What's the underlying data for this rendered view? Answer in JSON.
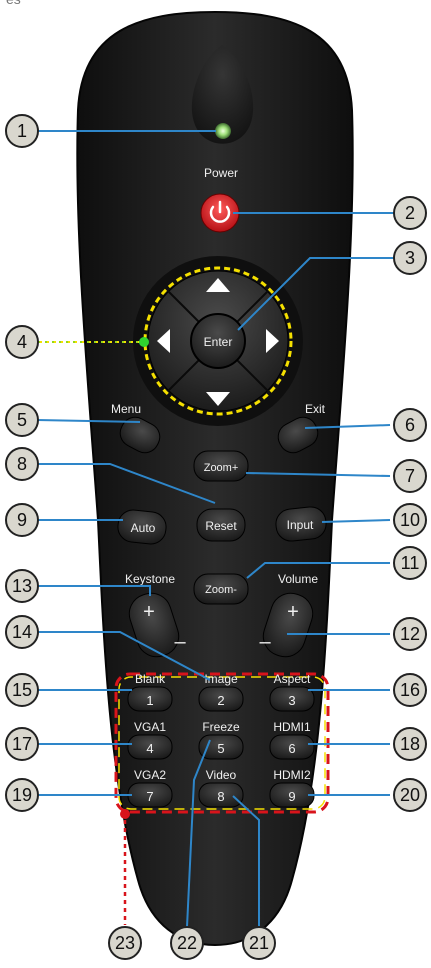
{
  "header": {
    "fragment": "es"
  },
  "remote": {
    "labels": {
      "power": "Power",
      "enter": "Enter",
      "menu": "Menu",
      "exit": "Exit",
      "zoom_plus": "Zoom+",
      "reset": "Reset",
      "auto": "Auto",
      "input": "Input",
      "zoom_minus": "Zoom-",
      "keystone": "Keystone",
      "volume": "Volume",
      "plus": "+",
      "minus": "–",
      "blank": "Blank",
      "image": "Image",
      "aspect": "Aspect",
      "vga1": "VGA1",
      "freeze": "Freeze",
      "hdmi1": "HDMI1",
      "vga2": "VGA2",
      "video": "Video",
      "hdmi2": "HDMI2",
      "num1": "1",
      "num2": "2",
      "num3": "3",
      "num4": "4",
      "num5": "5",
      "num6": "6",
      "num7": "7",
      "num8": "8",
      "num9": "9"
    }
  },
  "callouts": {
    "c1": "1",
    "c2": "2",
    "c3": "3",
    "c4": "4",
    "c5": "5",
    "c6": "6",
    "c7": "7",
    "c8": "8",
    "c9": "9",
    "c10": "10",
    "c11": "11",
    "c12": "12",
    "c13": "13",
    "c14": "14",
    "c15": "15",
    "c16": "16",
    "c17": "17",
    "c18": "18",
    "c19": "19",
    "c20": "20",
    "c21": "21",
    "c22": "22",
    "c23": "23"
  },
  "colors": {
    "body": "#1c1c1c",
    "button": "#2a2a2a",
    "power_red": "#e0262a",
    "led_green": "#9fe07a",
    "callout_fill": "#d9d7ce",
    "leader_blue": "#2e86c9",
    "dash_yellow": "#f5e000",
    "dash_red": "#d8141b",
    "green_dot": "#2fd42f"
  }
}
